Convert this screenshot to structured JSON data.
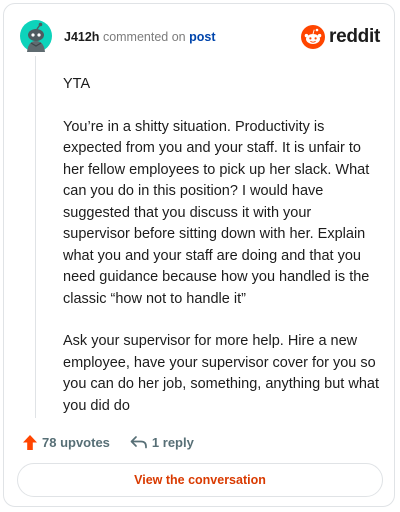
{
  "comment": {
    "username": "J412h",
    "action_text": "commented on",
    "post_link": "post",
    "paragraphs": [
      "YTA",
      "You’re in a shitty situation. Productivity is expected from you and your staff. It is unfair to her fellow employees to pick up her slack. What can you do in this position? I would have suggested that you discuss it with your supervisor before sitting down with her. Explain what you and your staff are doing and that you need guidance because how you handled is the classic “how not to handle it”",
      "Ask your supervisor for more help. Hire a new employee, have your supervisor cover for you so you can do her job, something, anything but what you did do"
    ]
  },
  "brand": {
    "wordmark": "reddit",
    "icon": "reddit-snoo-icon",
    "color": "#ff4500"
  },
  "avatar": {
    "icon": "snoo-avatar-icon",
    "color": "#0dd3bb"
  },
  "actions": {
    "upvotes": "78 upvotes",
    "upvote_icon": "upvote-arrow-icon",
    "upvote_color": "#ff4500",
    "replies": "1 reply",
    "reply_icon": "reply-arrow-icon"
  },
  "cta": {
    "label": "View the conversation",
    "color": "#d93a00"
  }
}
